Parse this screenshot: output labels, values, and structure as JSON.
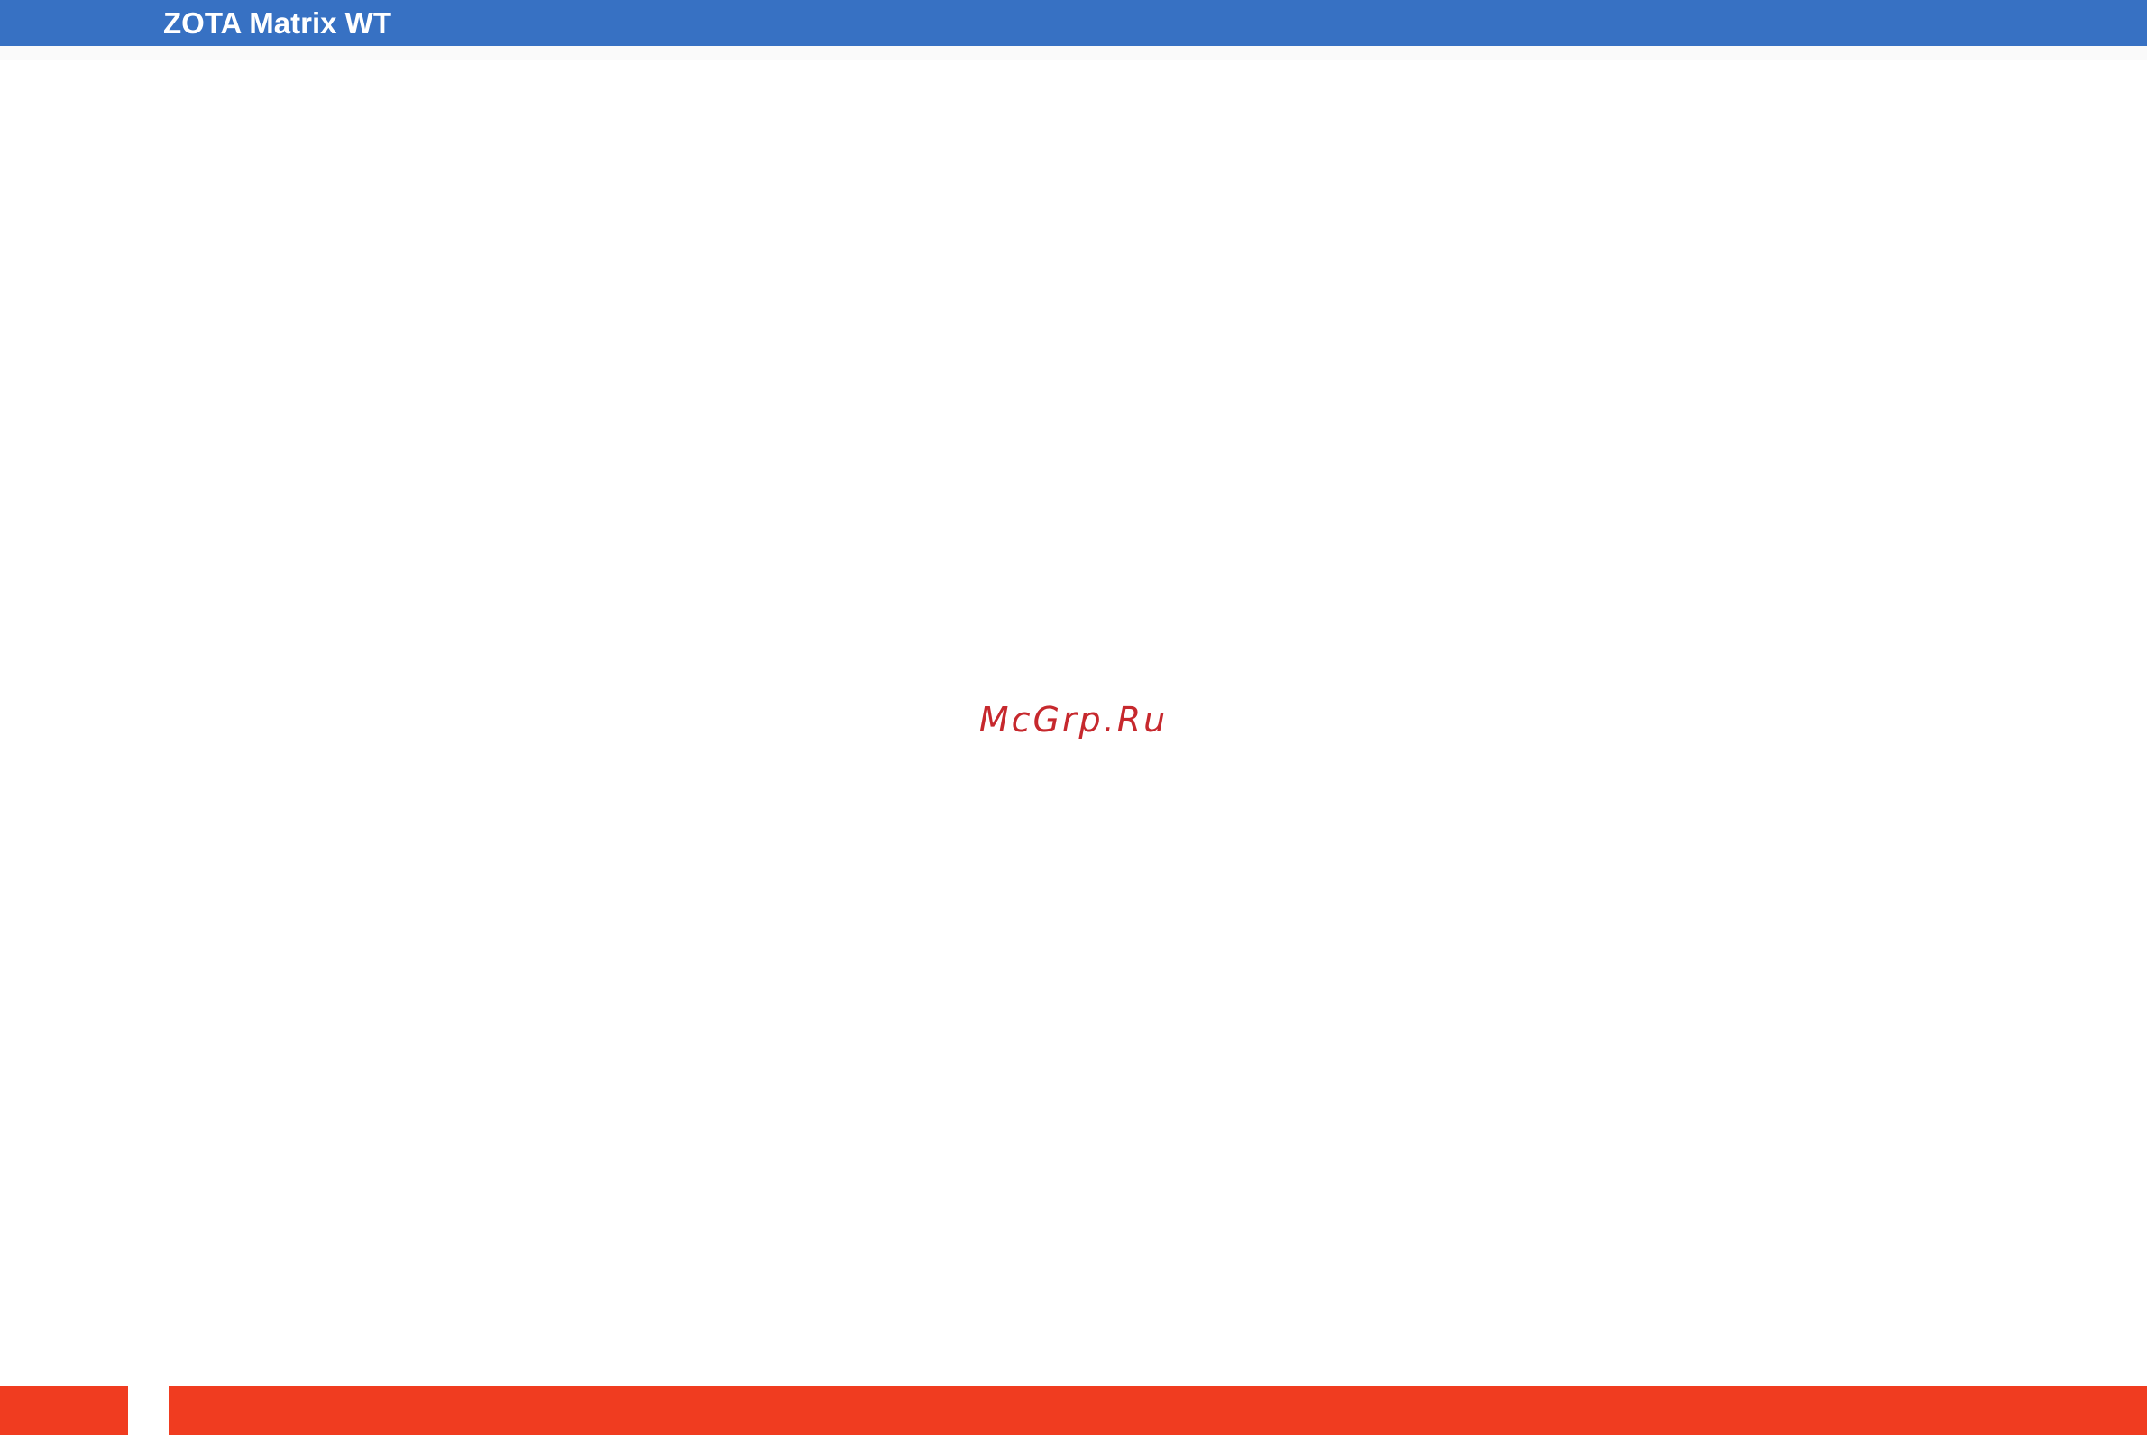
{
  "header": {
    "title": "ZOTA Matrix WT"
  },
  "main": {
    "watermark_text": "McGrp.Ru"
  },
  "colors": {
    "header_background": "#3771c3",
    "watermark": "#c6282d",
    "footer_band": "#f03c20"
  }
}
